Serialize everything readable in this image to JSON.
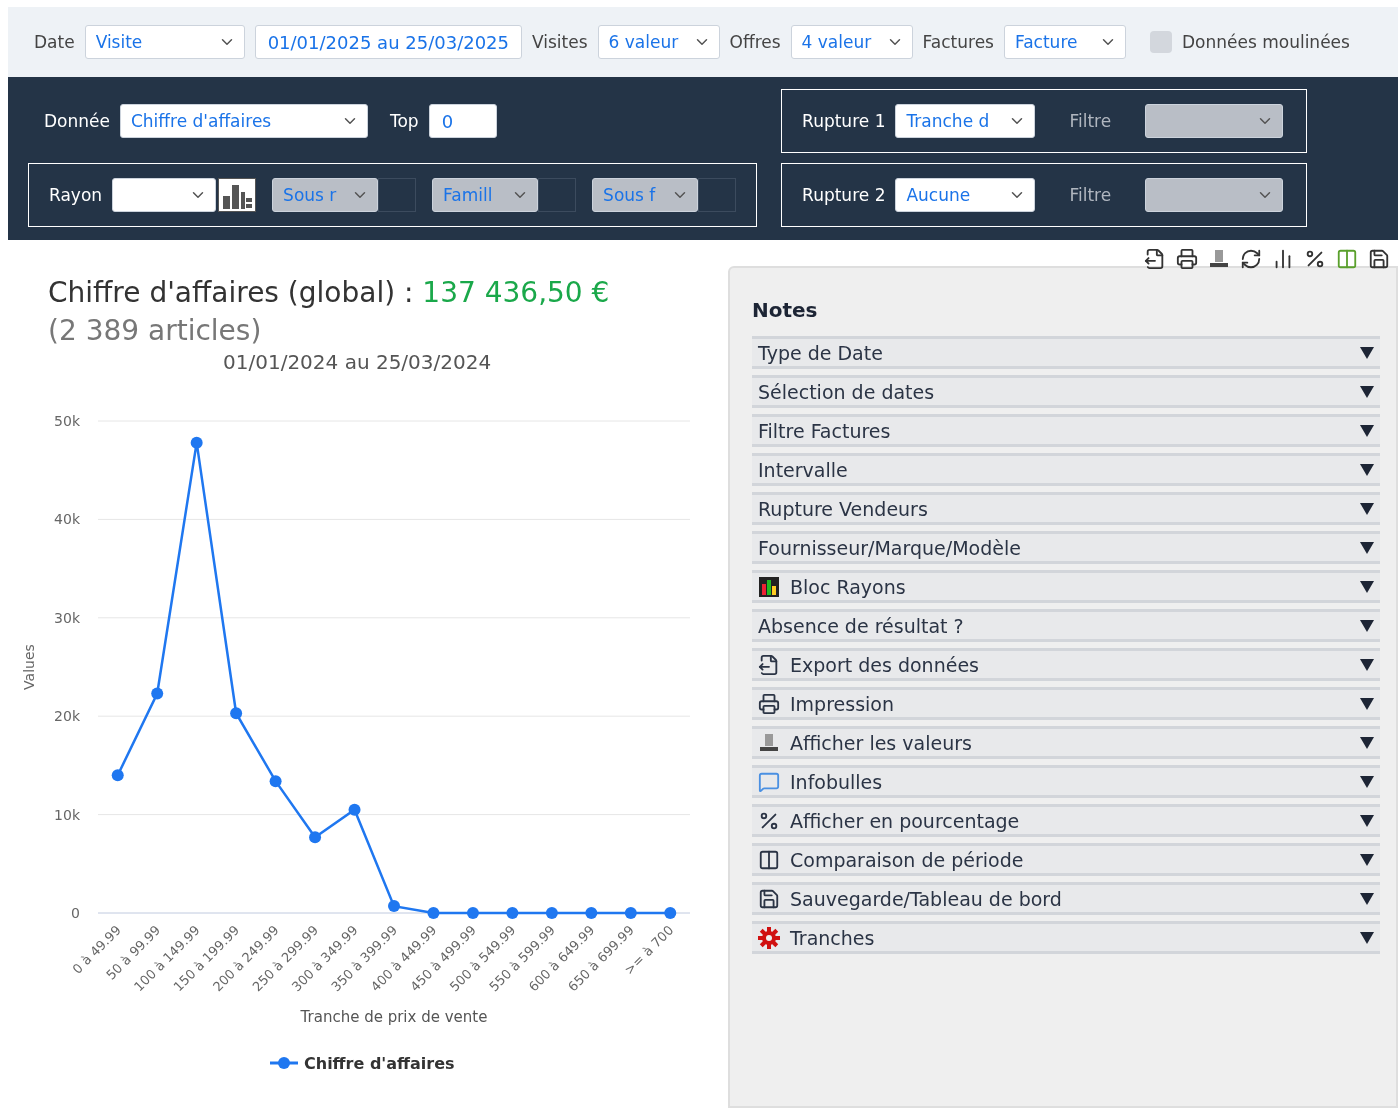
{
  "filters": [
    {
      "kind": "select",
      "label": "Date",
      "value": "Visite"
    },
    {
      "kind": "field",
      "value": "01/01/2025 au 25/03/2025"
    },
    {
      "kind": "select",
      "label": "Visites",
      "value": "6 valeur"
    },
    {
      "kind": "select",
      "label": "Offres",
      "value": "4 valeur"
    },
    {
      "kind": "select",
      "label": "Factures",
      "value": "Facture"
    },
    {
      "kind": "checkbox",
      "label": "Données moulinées",
      "checked": false
    }
  ],
  "settings": {
    "data_label": "Donnée",
    "data_value": "Chiffre d'affaires",
    "top_label": "Top",
    "top_value": "0",
    "rayon_label": "Rayon",
    "sub_selects": [
      {
        "value": "Sous r",
        "disabled": true
      },
      {
        "value": "Famill",
        "disabled": true
      },
      {
        "value": "Sous f",
        "disabled": true
      }
    ],
    "ruptures": [
      {
        "label": "Rupture 1",
        "value": "Tranche d",
        "filter_label": "Filtre",
        "filter_disabled": true
      },
      {
        "label": "Rupture 2",
        "value": "Aucune",
        "filter_label": "Filtre",
        "filter_disabled": true
      }
    ]
  },
  "chart": {
    "title": "Chiffre d'affaires (global) : ",
    "total": "137 436,50 €",
    "count": "(2 389 articles)",
    "period": "01/01/2024 au 25/03/2024",
    "chart_data": {
      "type": "line",
      "xlabel": "Tranche de prix de vente",
      "ylabel": "Values",
      "categories": [
        "0 à 49.99",
        "50 à 99.99",
        "100 à 149.99",
        "150 à 199.99",
        "200 à 249.99",
        "250 à 299.99",
        "300 à 349.99",
        "350 à 399.99",
        "400 à 449.99",
        "450 à 499.99",
        "500 à 549.99",
        "550 à 599.99",
        "600 à 649.99",
        "650 à 699.99",
        ">= à 700"
      ],
      "grid": true,
      "series": [
        {
          "name": "Chiffre d'affaires",
          "color": "#1f77f0",
          "marker": "circle",
          "values": [
            14000,
            22300,
            47800,
            20300,
            13400,
            7700,
            10500,
            700,
            0,
            0,
            0,
            0,
            0,
            0,
            0
          ]
        }
      ],
      "ylim": [
        0,
        50000
      ],
      "yticks": [
        {
          "value": 0,
          "label": "0"
        },
        {
          "value": 10000,
          "label": "10k"
        },
        {
          "value": 20000,
          "label": "20k"
        },
        {
          "value": 30000,
          "label": "30k"
        },
        {
          "value": 40000,
          "label": "40k"
        },
        {
          "value": 50000,
          "label": "50k"
        }
      ]
    }
  },
  "notes": {
    "title": "Notes",
    "items": [
      {
        "label": "Type de Date",
        "expanded": false
      },
      {
        "label": "Sélection de dates",
        "expanded": false
      },
      {
        "label": "Filtre Factures",
        "expanded": false
      },
      {
        "label": "Intervalle",
        "expanded": false
      },
      {
        "label": "Rupture Vendeurs",
        "expanded": false
      },
      {
        "label": "Fournisseur/Marque/Modèle",
        "expanded": false
      },
      {
        "label": "Bloc Rayons",
        "expanded": false
      },
      {
        "label": "Absence de résultat ?",
        "expanded": false
      },
      {
        "label": "Export des données",
        "expanded": false
      },
      {
        "label": "Impression",
        "expanded": false
      },
      {
        "label": "Afficher les valeurs",
        "expanded": false
      },
      {
        "label": "Infobulles",
        "expanded": false
      },
      {
        "label": "Afficher en pourcentage",
        "expanded": false
      },
      {
        "label": "Comparaison de période",
        "expanded": false
      },
      {
        "label": "Sauvegarde/Tableau de bord",
        "expanded": false
      },
      {
        "label": "Tranches",
        "expanded": false
      }
    ]
  }
}
